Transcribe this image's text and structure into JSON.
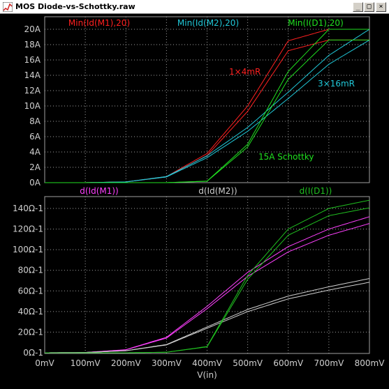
{
  "window": {
    "title": "MOS Diode-vs-Schottky.raw",
    "minimize_glyph": "_",
    "maximize_glyph": "□",
    "close_glyph": "×"
  },
  "colors": {
    "m1": "#ff2020",
    "m2": "#20c8d8",
    "d1": "#20e020",
    "dm1": "#ff40ff",
    "dm2": "#d0d0d0",
    "dd1": "#20c020",
    "grid": "#a0a0a0",
    "tick_text": "#d0d0d0"
  },
  "chart_data": [
    {
      "type": "line",
      "x": [
        0,
        100,
        200,
        300,
        400,
        500,
        600,
        700,
        800
      ],
      "xunit": "mV",
      "ylim": [
        0,
        20
      ],
      "yticks": [
        "0A",
        "2A",
        "4A",
        "6A",
        "8A",
        "10A",
        "12A",
        "14A",
        "16A",
        "18A",
        "20A"
      ],
      "legend": [
        "Min(Id(M1),20)",
        "Min(Id(M2),20)",
        "Min(I(D1),20)"
      ],
      "annotations": [
        "1×4mR",
        "3×16mR",
        "15A Schottky"
      ],
      "series": [
        {
          "name": "Min(Id(M1),20)",
          "values": [
            0,
            0,
            0.1,
            0.8,
            3.8,
            10.0,
            18.5,
            20,
            20
          ]
        },
        {
          "name": "Min(Id(M2),20)",
          "values": [
            0,
            0,
            0.1,
            0.8,
            3.5,
            7.2,
            11.8,
            16.6,
            20
          ]
        },
        {
          "name": "Min(I(D1),20)",
          "values": [
            0,
            0,
            0,
            0,
            0.2,
            5.0,
            14.5,
            20,
            20
          ]
        }
      ]
    },
    {
      "type": "line",
      "x": [
        0,
        100,
        200,
        300,
        400,
        500,
        600,
        700,
        800
      ],
      "xunit": "mV",
      "ylim": [
        0,
        150
      ],
      "yticks": [
        "0Ω-1",
        "20Ω-1",
        "40Ω-1",
        "60Ω-1",
        "80Ω-1",
        "100Ω-1",
        "120Ω-1",
        "140Ω-1"
      ],
      "xticks": [
        "0mV",
        "100mV",
        "200mV",
        "300mV",
        "400mV",
        "500mV",
        "600mV",
        "700mV",
        "800mV"
      ],
      "xlabel": "V(in)",
      "legend": [
        "d(Id(M1))",
        "d(Id(M2))",
        "d(I(D1))"
      ],
      "series": [
        {
          "name": "d(Id(M1))",
          "values": [
            0,
            0.3,
            3,
            15,
            45,
            78,
            103,
            120,
            132
          ]
        },
        {
          "name": "d(Id(M2))",
          "values": [
            0,
            0.3,
            2,
            8,
            25,
            42,
            55,
            64,
            72
          ]
        },
        {
          "name": "d(I(D1))",
          "values": [
            0,
            0,
            0,
            0.5,
            6,
            75,
            120,
            140,
            148
          ]
        }
      ]
    }
  ]
}
